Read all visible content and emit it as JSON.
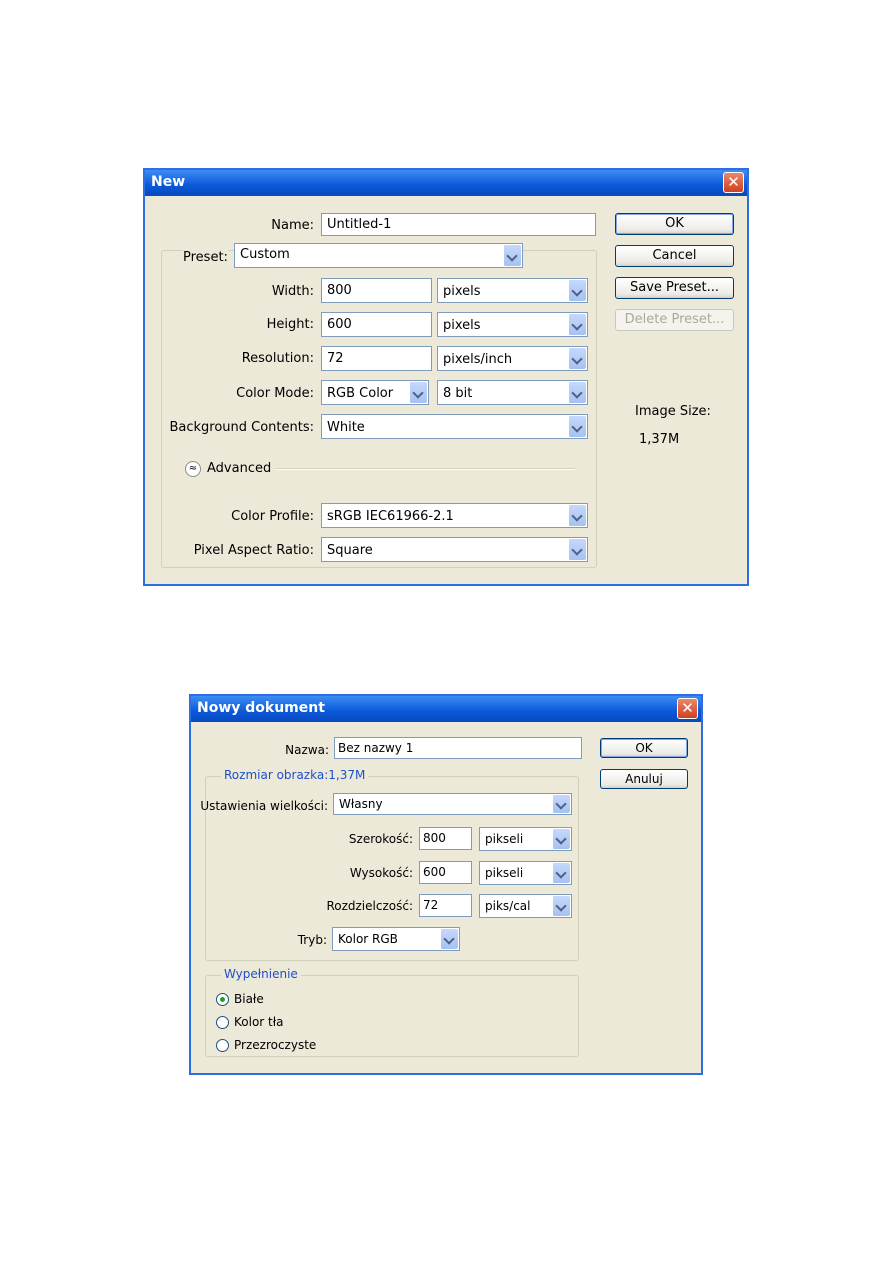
{
  "dialog1": {
    "title": "New",
    "name_label": "Name:",
    "name_value": "Untitled-1",
    "preset_label": "Preset:",
    "preset_value": "Custom",
    "width_label": "Width:",
    "width_value": "800",
    "width_unit": "pixels",
    "height_label": "Height:",
    "height_value": "600",
    "height_unit": "pixels",
    "resolution_label": "Resolution:",
    "resolution_value": "72",
    "resolution_unit": "pixels/inch",
    "color_mode_label": "Color Mode:",
    "color_mode_value": "RGB Color",
    "bit_depth_value": "8 bit",
    "background_label": "Background Contents:",
    "background_value": "White",
    "advanced_label": "Advanced",
    "advanced_icon": "double-chevron-up-icon",
    "color_profile_label": "Color Profile:",
    "color_profile_value": "sRGB IEC61966-2.1",
    "pixel_aspect_label": "Pixel Aspect Ratio:",
    "pixel_aspect_value": "Square",
    "ok_label": "OK",
    "cancel_label": "Cancel",
    "save_preset_label": "Save Preset...",
    "delete_preset_label": "Delete Preset...",
    "image_size_label": "Image Size:",
    "image_size_value": "1,37M"
  },
  "dialog2": {
    "title": "Nowy dokument",
    "name_label": "Nazwa:",
    "name_value": "Bez nazwy 1",
    "group_image_size_title": "Rozmiar obrazka:1,37M",
    "preset_label": "Ustawienia wielkości:",
    "preset_value": "Własny",
    "width_label": "Szerokość:",
    "width_value": "800",
    "width_unit": "pikseli",
    "height_label": "Wysokość:",
    "height_value": "600",
    "height_unit": "pikseli",
    "resolution_label": "Rozdzielczość:",
    "resolution_value": "72",
    "resolution_unit": "piks/cal",
    "mode_label": "Tryb:",
    "mode_value": "Kolor RGB",
    "ok_label": "OK",
    "cancel_label": "Anuluj",
    "fill_group_title": "Wypełnienie",
    "fill_options": [
      "Białe",
      "Kolor tła",
      "Przezroczyste"
    ],
    "fill_selected_index": 0
  },
  "colors": {
    "title_bar": "#0a58d8",
    "dialog_bg": "#ece9d8",
    "group_title": "#1e50c8",
    "close_button": "#d1401f"
  }
}
